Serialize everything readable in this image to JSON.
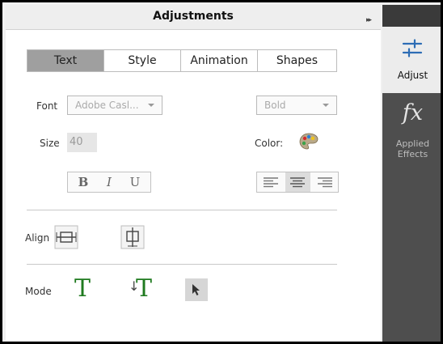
{
  "panel": {
    "title": "Adjustments"
  },
  "tabs": [
    {
      "label": "Text",
      "active": true
    },
    {
      "label": "Style",
      "active": false
    },
    {
      "label": "Animation",
      "active": false
    },
    {
      "label": "Shapes",
      "active": false
    }
  ],
  "font": {
    "label": "Font",
    "value": "Adobe Casl...",
    "weight": "Bold"
  },
  "size": {
    "label": "Size",
    "value": "40"
  },
  "color": {
    "label": "Color:"
  },
  "style_buttons": {
    "bold": "B",
    "italic": "I",
    "underline": "U"
  },
  "align_text": {
    "left": "left",
    "center": "center",
    "right": "right",
    "selected": "center"
  },
  "align": {
    "label": "Align"
  },
  "mode": {
    "label": "Mode",
    "horizontal_glyph": "T",
    "vertical_glyph": "T"
  },
  "sidebar": {
    "adjust_label": "Adjust",
    "fx_glyph": "fx",
    "applied_label_1": "Applied",
    "applied_label_2": "Effects"
  },
  "colors": {
    "sidebar_dark": "#4e4e4e",
    "active_tab": "#9f9f9f",
    "mode_text_green": "#1f7a1f"
  }
}
